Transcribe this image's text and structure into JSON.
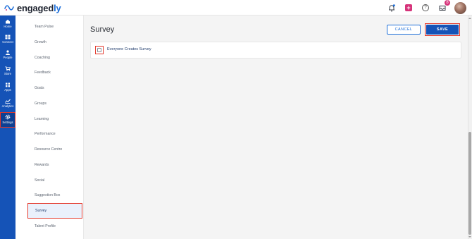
{
  "brand": {
    "logo_main": "engaged",
    "logo_accent": "ly",
    "brand_color": "#1e6fd9"
  },
  "topbar": {
    "icons": [
      "bell-icon",
      "plus-icon",
      "help-icon",
      "inbox-icon",
      "avatar"
    ],
    "plus_glyph": "+",
    "help_glyph": "?",
    "inbox_badge": "8"
  },
  "rail": {
    "items": [
      {
        "label": "Home",
        "icon": "home-icon"
      },
      {
        "label": "Connect",
        "icon": "connect-icon"
      },
      {
        "label": "People",
        "icon": "people-icon"
      },
      {
        "label": "Store",
        "icon": "cart-icon"
      },
      {
        "label": "Apps",
        "icon": "apps-icon"
      },
      {
        "label": "Analytics",
        "icon": "analytics-icon"
      },
      {
        "label": "Settings",
        "icon": "gear-icon",
        "active": true
      }
    ]
  },
  "submenu": {
    "items": [
      {
        "label": "Team Pulse"
      },
      {
        "label": "Growth"
      },
      {
        "label": "Coaching"
      },
      {
        "label": "Feedback"
      },
      {
        "label": "Goals"
      },
      {
        "label": "Groups"
      },
      {
        "label": "Learning"
      },
      {
        "label": "Performance"
      },
      {
        "label": "Resource Centre"
      },
      {
        "label": "Rewards"
      },
      {
        "label": "Social"
      },
      {
        "label": "Suggestion Box"
      },
      {
        "label": "Survey",
        "selected": true
      },
      {
        "label": "Talent Profile"
      }
    ]
  },
  "main": {
    "title": "Survey",
    "cancel_label": "CANCEL",
    "save_label": "SAVE",
    "option": {
      "label": "Everyone Creates Survey",
      "checked": false
    }
  },
  "colors": {
    "rail_bg": "#1553b7",
    "highlight": "#e4372a",
    "accent": "#1e6fd9",
    "plus_badge": "#d6337a"
  }
}
